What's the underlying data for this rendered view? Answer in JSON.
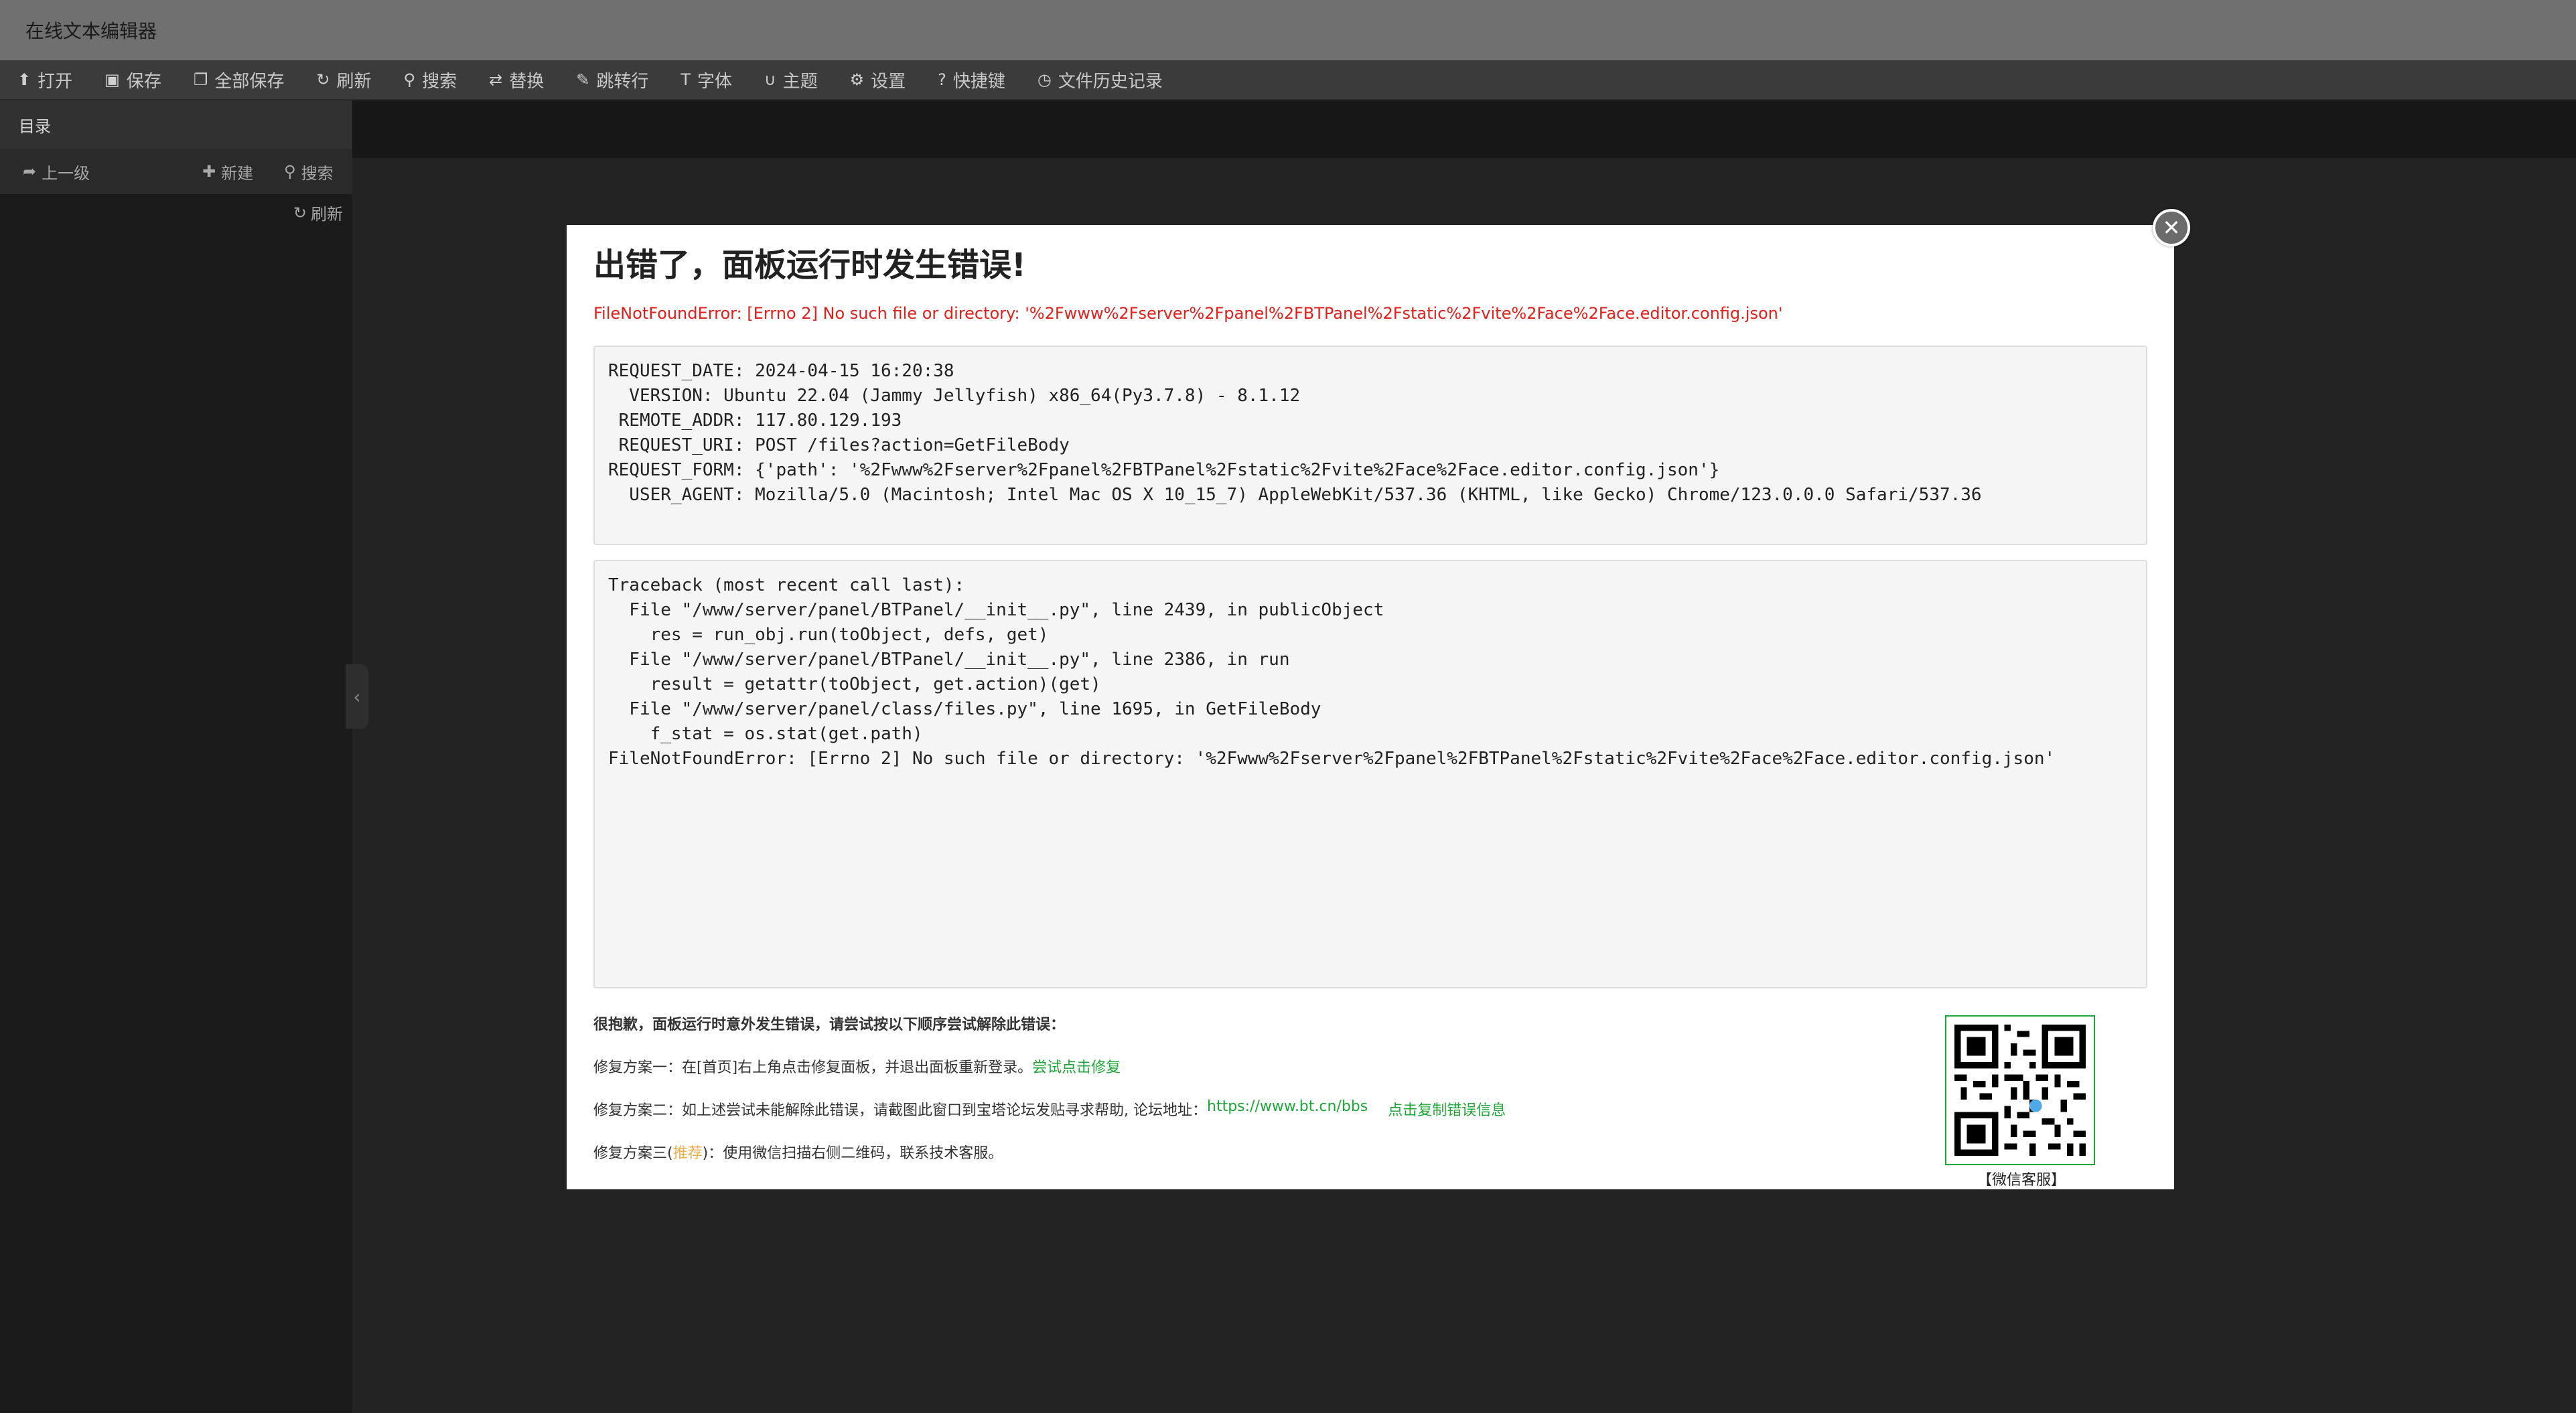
{
  "app": {
    "title": "在线文本编辑器"
  },
  "toolbar": {
    "items": [
      {
        "icon": "upload-icon",
        "label": "打开"
      },
      {
        "icon": "save-icon",
        "label": "保存"
      },
      {
        "icon": "save-all-icon",
        "label": "全部保存"
      },
      {
        "icon": "refresh-icon",
        "label": "刷新"
      },
      {
        "icon": "search-icon",
        "label": "搜索"
      },
      {
        "icon": "replace-icon",
        "label": "替换"
      },
      {
        "icon": "goto-line-icon",
        "label": "跳转行"
      },
      {
        "icon": "font-icon",
        "label": "字体"
      },
      {
        "icon": "theme-icon",
        "label": "主题"
      },
      {
        "icon": "gear-icon",
        "label": "设置"
      },
      {
        "icon": "help-icon",
        "label": "快捷键"
      },
      {
        "icon": "history-icon",
        "label": "文件历史记录"
      }
    ]
  },
  "sidebar": {
    "header": "目录",
    "up_label": "上一级",
    "new_label": "新建",
    "search_label": "搜索",
    "refresh_label": "刷新"
  },
  "modal": {
    "title": "出错了，面板运行时发生错误!",
    "error_line": "FileNotFoundError: [Errno 2] No such file or directory: '%2Fwww%2Fserver%2Fpanel%2FBTPanel%2Fstatic%2Fvite%2Face%2Face.editor.config.json'",
    "request_info": "REQUEST_DATE: 2024-04-15 16:20:38\n  VERSION: Ubuntu 22.04 (Jammy Jellyfish) x86_64(Py3.7.8) - 8.1.12\n REMOTE_ADDR: 117.80.129.193\n REQUEST_URI: POST /files?action=GetFileBody\nREQUEST_FORM: {'path': '%2Fwww%2Fserver%2Fpanel%2FBTPanel%2Fstatic%2Fvite%2Face%2Face.editor.config.json'}\n  USER_AGENT: Mozilla/5.0 (Macintosh; Intel Mac OS X 10_15_7) AppleWebKit/537.36 (KHTML, like Gecko) Chrome/123.0.0.0 Safari/537.36",
    "traceback": "Traceback (most recent call last):\n  File \"/www/server/panel/BTPanel/__init__.py\", line 2439, in publicObject\n    res = run_obj.run(toObject, defs, get)\n  File \"/www/server/panel/BTPanel/__init__.py\", line 2386, in run\n    result = getattr(toObject, get.action)(get)\n  File \"/www/server/panel/class/files.py\", line 1695, in GetFileBody\n    f_stat = os.stat(get.path)\nFileNotFoundError: [Errno 2] No such file or directory: '%2Fwww%2Fserver%2Fpanel%2FBTPanel%2Fstatic%2Fvite%2Face%2Face.editor.config.json'",
    "help_intro": "很抱歉，面板运行时意外发生错误，请尝试按以下顺序尝试解除此错误：",
    "plan1_text": "修复方案一：在[首页]右上角点击修复面板，并退出面板重新登录。",
    "plan1_link": "尝试点击修复",
    "plan2_text": "修复方案二：如上述尝试未能解除此错误，请截图此窗口到宝塔论坛发贴寻求帮助, 论坛地址：",
    "plan2_link": "https://www.bt.cn/bbs",
    "plan2_copy": "点击复制错误信息",
    "plan3_prefix": "修复方案三(",
    "plan3_highlight": "推荐",
    "plan3_suffix": ")：使用微信扫描右侧二维码，联系技术客服。",
    "qr_label": "【微信客服】"
  },
  "colors": {
    "accent_green": "#20a53a",
    "error_red": "#e0201b",
    "highlight_orange": "#f0ad4e"
  }
}
